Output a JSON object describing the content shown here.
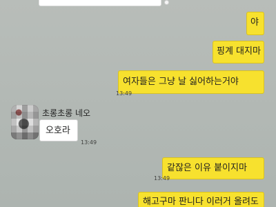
{
  "messages": {
    "m1": {
      "text": "야"
    },
    "m2": {
      "text": "핑계 대지마"
    },
    "m3": {
      "text": "여자들은 그냥 날 싫어하는거야"
    },
    "m4": {
      "text": "오호라"
    },
    "m5": {
      "text": "같잖은 이유 붙이지마"
    },
    "m6": {
      "text": "해고구마 판니다 이러거 올려도"
    }
  },
  "times": {
    "t1": "13:49",
    "t2": "13:49",
    "t3": "13:49"
  },
  "sender": {
    "name": "초롱초롱 네오"
  },
  "colors": {
    "background": "#b2b8b5",
    "my_bubble": "#f7e12e",
    "other_bubble": "#ffffff"
  }
}
